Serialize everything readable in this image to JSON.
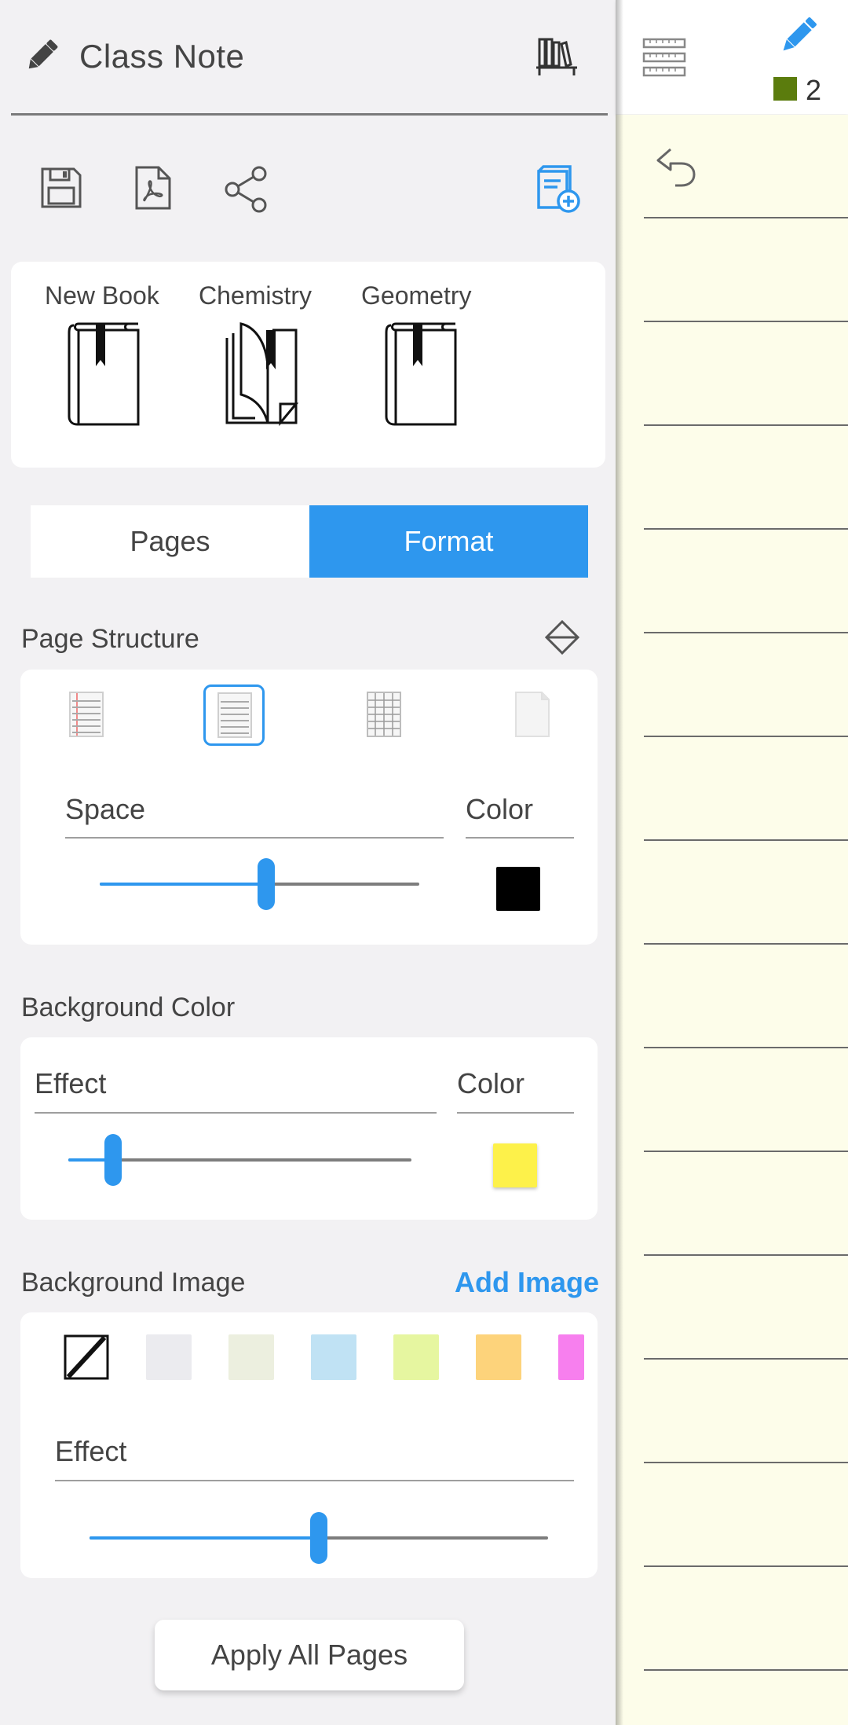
{
  "app": {
    "title": "Class Note"
  },
  "toolbar": {
    "icons": [
      "pencil-icon",
      "bookshelf-icon",
      "save-icon",
      "pdf-icon",
      "share-icon",
      "add-book-icon"
    ]
  },
  "books": [
    {
      "label": "New Book",
      "icon": "book-icon"
    },
    {
      "label": "Chemistry",
      "icon": "open-book-icon"
    },
    {
      "label": "Geometry",
      "icon": "book-icon"
    }
  ],
  "tabs": {
    "pages": "Pages",
    "format": "Format",
    "active": "format"
  },
  "page_structure": {
    "title": "Page Structure",
    "options": [
      "lined-red-margin",
      "lined",
      "grid",
      "blank"
    ],
    "selected": "lined",
    "space_label": "Space",
    "color_label": "Color",
    "space_value": 0.52,
    "line_color": "#000000"
  },
  "background_color": {
    "title": "Background Color",
    "effect_label": "Effect",
    "color_label": "Color",
    "effect_value": 0.13,
    "color": "#fdf14a"
  },
  "background_image": {
    "title": "Background Image",
    "add_label": "Add Image",
    "swatches": [
      "none",
      "#ebebef",
      "#ecefdf",
      "#c0e2f4",
      "#e6f6a0",
      "#fdd37b",
      "#f77fee"
    ],
    "effect_label": "Effect",
    "effect_value": 0.5
  },
  "apply_label": "Apply All Pages",
  "note": {
    "page_count": "2",
    "page_color_indicator": "#5b7c0d",
    "pen_color": "#2e97ee",
    "paper_color": "#fdfdea"
  }
}
